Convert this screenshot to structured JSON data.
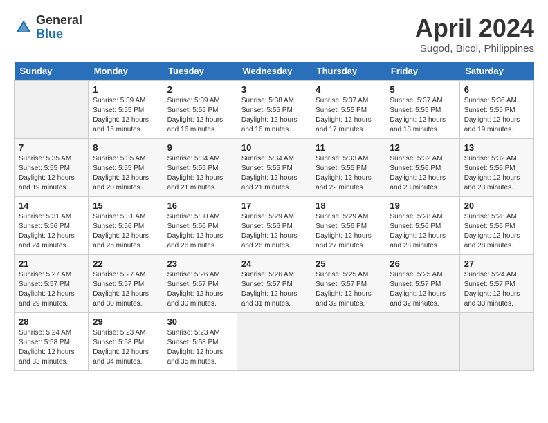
{
  "header": {
    "logo_general": "General",
    "logo_blue": "Blue",
    "month_title": "April 2024",
    "subtitle": "Sugod, Bicol, Philippines"
  },
  "days_of_week": [
    "Sunday",
    "Monday",
    "Tuesday",
    "Wednesday",
    "Thursday",
    "Friday",
    "Saturday"
  ],
  "weeks": [
    [
      {
        "day": "",
        "info": ""
      },
      {
        "day": "1",
        "info": "Sunrise: 5:39 AM\nSunset: 5:55 PM\nDaylight: 12 hours\nand 15 minutes."
      },
      {
        "day": "2",
        "info": "Sunrise: 5:39 AM\nSunset: 5:55 PM\nDaylight: 12 hours\nand 16 minutes."
      },
      {
        "day": "3",
        "info": "Sunrise: 5:38 AM\nSunset: 5:55 PM\nDaylight: 12 hours\nand 16 minutes."
      },
      {
        "day": "4",
        "info": "Sunrise: 5:37 AM\nSunset: 5:55 PM\nDaylight: 12 hours\nand 17 minutes."
      },
      {
        "day": "5",
        "info": "Sunrise: 5:37 AM\nSunset: 5:55 PM\nDaylight: 12 hours\nand 18 minutes."
      },
      {
        "day": "6",
        "info": "Sunrise: 5:36 AM\nSunset: 5:55 PM\nDaylight: 12 hours\nand 19 minutes."
      }
    ],
    [
      {
        "day": "7",
        "info": "Sunrise: 5:35 AM\nSunset: 5:55 PM\nDaylight: 12 hours\nand 19 minutes."
      },
      {
        "day": "8",
        "info": "Sunrise: 5:35 AM\nSunset: 5:55 PM\nDaylight: 12 hours\nand 20 minutes."
      },
      {
        "day": "9",
        "info": "Sunrise: 5:34 AM\nSunset: 5:55 PM\nDaylight: 12 hours\nand 21 minutes."
      },
      {
        "day": "10",
        "info": "Sunrise: 5:34 AM\nSunset: 5:55 PM\nDaylight: 12 hours\nand 21 minutes."
      },
      {
        "day": "11",
        "info": "Sunrise: 5:33 AM\nSunset: 5:55 PM\nDaylight: 12 hours\nand 22 minutes."
      },
      {
        "day": "12",
        "info": "Sunrise: 5:32 AM\nSunset: 5:56 PM\nDaylight: 12 hours\nand 23 minutes."
      },
      {
        "day": "13",
        "info": "Sunrise: 5:32 AM\nSunset: 5:56 PM\nDaylight: 12 hours\nand 23 minutes."
      }
    ],
    [
      {
        "day": "14",
        "info": "Sunrise: 5:31 AM\nSunset: 5:56 PM\nDaylight: 12 hours\nand 24 minutes."
      },
      {
        "day": "15",
        "info": "Sunrise: 5:31 AM\nSunset: 5:56 PM\nDaylight: 12 hours\nand 25 minutes."
      },
      {
        "day": "16",
        "info": "Sunrise: 5:30 AM\nSunset: 5:56 PM\nDaylight: 12 hours\nand 26 minutes."
      },
      {
        "day": "17",
        "info": "Sunrise: 5:29 AM\nSunset: 5:56 PM\nDaylight: 12 hours\nand 26 minutes."
      },
      {
        "day": "18",
        "info": "Sunrise: 5:29 AM\nSunset: 5:56 PM\nDaylight: 12 hours\nand 27 minutes."
      },
      {
        "day": "19",
        "info": "Sunrise: 5:28 AM\nSunset: 5:56 PM\nDaylight: 12 hours\nand 28 minutes."
      },
      {
        "day": "20",
        "info": "Sunrise: 5:28 AM\nSunset: 5:56 PM\nDaylight: 12 hours\nand 28 minutes."
      }
    ],
    [
      {
        "day": "21",
        "info": "Sunrise: 5:27 AM\nSunset: 5:57 PM\nDaylight: 12 hours\nand 29 minutes."
      },
      {
        "day": "22",
        "info": "Sunrise: 5:27 AM\nSunset: 5:57 PM\nDaylight: 12 hours\nand 30 minutes."
      },
      {
        "day": "23",
        "info": "Sunrise: 5:26 AM\nSunset: 5:57 PM\nDaylight: 12 hours\nand 30 minutes."
      },
      {
        "day": "24",
        "info": "Sunrise: 5:26 AM\nSunset: 5:57 PM\nDaylight: 12 hours\nand 31 minutes."
      },
      {
        "day": "25",
        "info": "Sunrise: 5:25 AM\nSunset: 5:57 PM\nDaylight: 12 hours\nand 32 minutes."
      },
      {
        "day": "26",
        "info": "Sunrise: 5:25 AM\nSunset: 5:57 PM\nDaylight: 12 hours\nand 32 minutes."
      },
      {
        "day": "27",
        "info": "Sunrise: 5:24 AM\nSunset: 5:57 PM\nDaylight: 12 hours\nand 33 minutes."
      }
    ],
    [
      {
        "day": "28",
        "info": "Sunrise: 5:24 AM\nSunset: 5:58 PM\nDaylight: 12 hours\nand 33 minutes."
      },
      {
        "day": "29",
        "info": "Sunrise: 5:23 AM\nSunset: 5:58 PM\nDaylight: 12 hours\nand 34 minutes."
      },
      {
        "day": "30",
        "info": "Sunrise: 5:23 AM\nSunset: 5:58 PM\nDaylight: 12 hours\nand 35 minutes."
      },
      {
        "day": "",
        "info": ""
      },
      {
        "day": "",
        "info": ""
      },
      {
        "day": "",
        "info": ""
      },
      {
        "day": "",
        "info": ""
      }
    ]
  ]
}
